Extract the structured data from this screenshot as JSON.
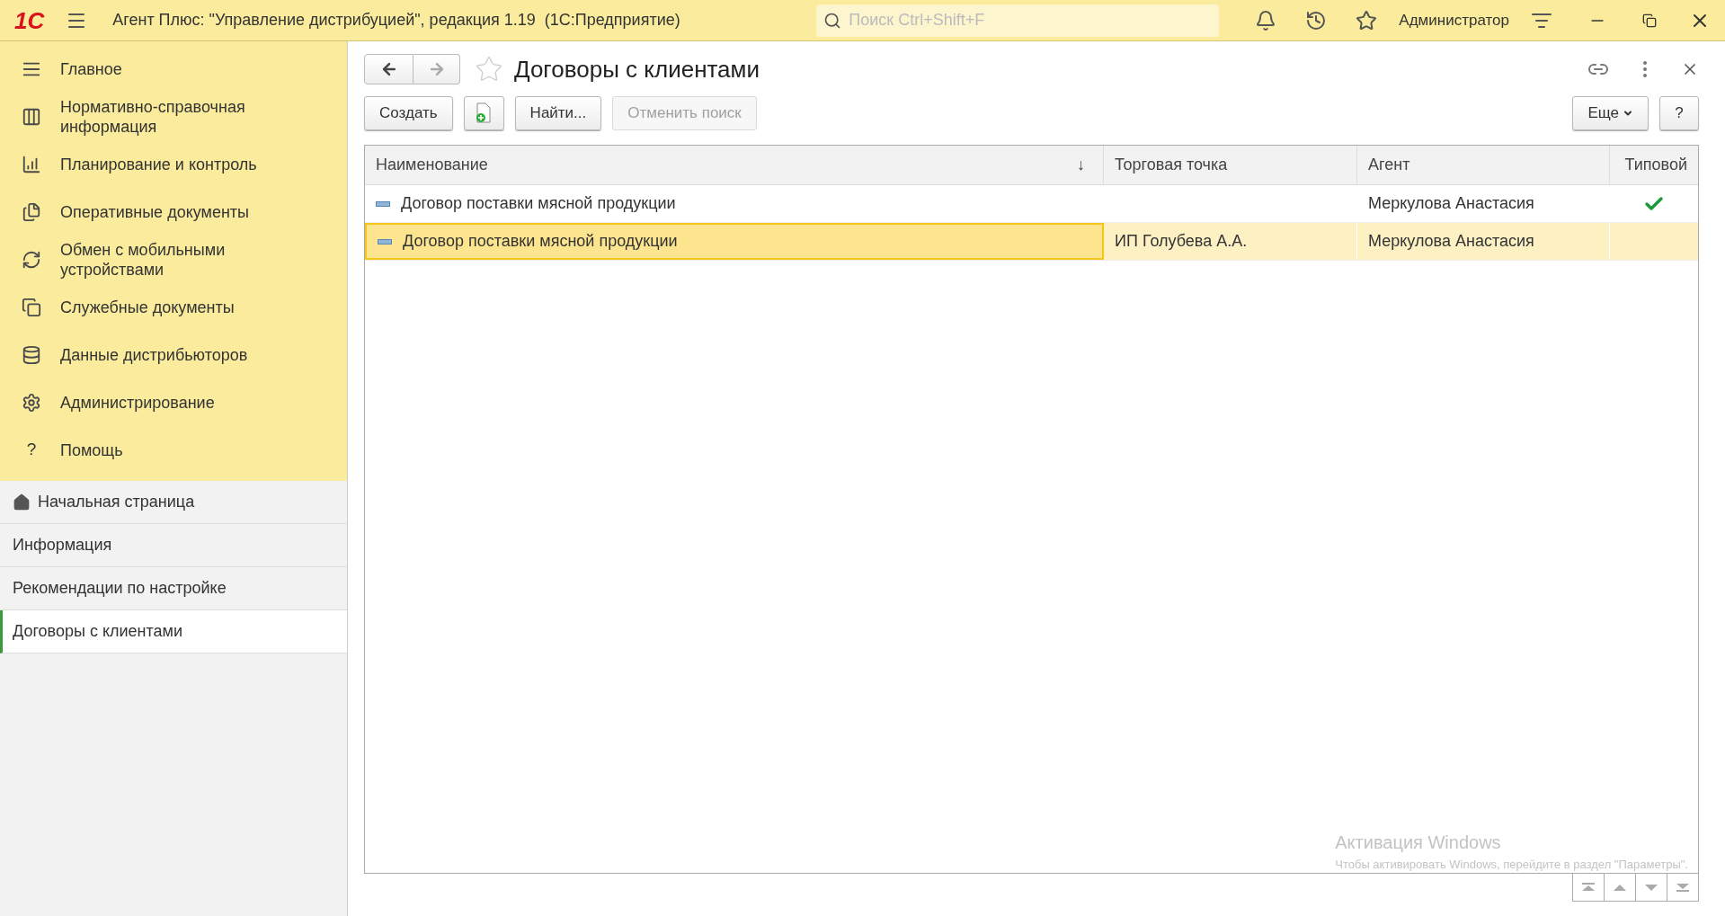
{
  "titlebar": {
    "logo": "1С",
    "title": "Агент Плюс: \"Управление дистрибуцией\", редакция 1.19  (1С:Предприятие)",
    "search": {
      "placeholder": "Поиск Ctrl+Shift+F"
    },
    "user": "Администратор"
  },
  "sections": [
    {
      "label": "Главное"
    },
    {
      "label": "Нормативно-справочная информация"
    },
    {
      "label": "Планирование и контроль"
    },
    {
      "label": "Оперативные документы"
    },
    {
      "label": "Обмен с мобильными устройствами"
    },
    {
      "label": "Служебные документы"
    },
    {
      "label": "Данные дистрибьюторов"
    },
    {
      "label": "Администрирование"
    },
    {
      "label": "Помощь",
      "glyph": "?"
    }
  ],
  "open_pages": [
    {
      "label": "Начальная страница",
      "selected": false,
      "kind": "home"
    },
    {
      "label": "Информация",
      "selected": false,
      "kind": "plain"
    },
    {
      "label": "Рекомендации по настройке",
      "selected": false,
      "kind": "plain"
    },
    {
      "label": "Договоры с клиентами",
      "selected": true,
      "kind": "plain"
    }
  ],
  "form": {
    "title": "Договоры с клиентами",
    "back_disabled": false,
    "forward_disabled": true,
    "buttons": [
      {
        "label": "Создать",
        "disabled": false
      },
      {
        "label": "Найти...",
        "disabled": false
      },
      {
        "label": "Отменить поиск",
        "disabled": true
      }
    ],
    "more_button": "Еще",
    "help_button": "?"
  },
  "table": {
    "columns": [
      {
        "label": "Наименование",
        "sort_glyph": "↓"
      },
      {
        "label": "Торговая точка"
      },
      {
        "label": "Агент"
      },
      {
        "label": "Типовой"
      }
    ],
    "rows": [
      {
        "name": "Договор поставки мясной продукции",
        "outlet": "",
        "agent": "Меркулова Анастасия",
        "typical": true,
        "selected": false
      },
      {
        "name": "Договор поставки мясной продукции",
        "outlet": "ИП Голубева А.А.",
        "agent": "Меркулова Анастасия",
        "typical": false,
        "selected": true
      }
    ]
  },
  "os_watermark": {
    "title": "Активация Windows",
    "text": "Чтобы активировать Windows, перейдите в раздел \"Параметры\"."
  }
}
